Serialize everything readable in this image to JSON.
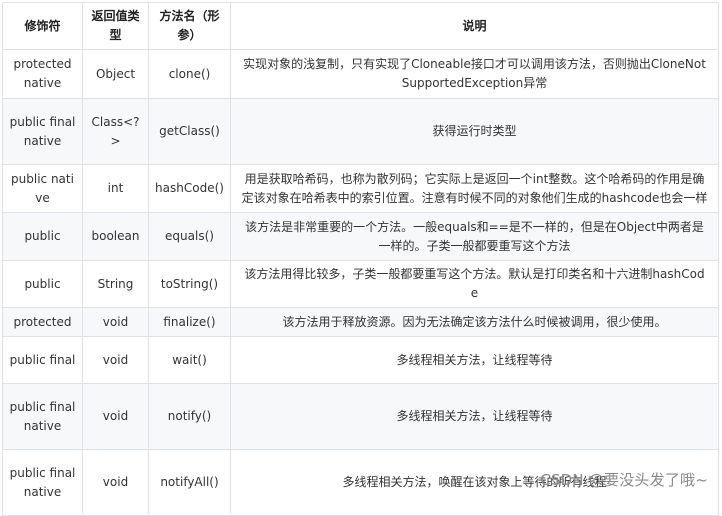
{
  "headers": {
    "modifier": "修饰符",
    "return_type": "返回值类型",
    "method": "方法名（形参）",
    "description": "说明"
  },
  "rows": [
    {
      "modifier": "protected native",
      "return_type": "Object",
      "method": "clone()",
      "description": "实现对象的浅复制，只有实现了Cloneable接口才可以调用该方法，否则抛出CloneNotSupportedException异常"
    },
    {
      "modifier": "public final native",
      "return_type": "Class<?>",
      "method": "getClass()",
      "description": "获得运行时类型"
    },
    {
      "modifier": "public native",
      "return_type": "int",
      "method": "hashCode()",
      "description": "用是获取哈希码，也称为散列码；它实际上是返回一个int整数。这个哈希码的作用是确定该对象在哈希表中的索引位置。注意有时候不同的对象他们生成的hashcode也会一样"
    },
    {
      "modifier": "public",
      "return_type": "boolean",
      "method": "equals()",
      "description": "该方法是非常重要的一个方法。一般equals和==是不一样的，但是在Object中两者是一样的。子类一般都要重写这个方法"
    },
    {
      "modifier": "public",
      "return_type": "String",
      "method": "toString()",
      "description": "该方法用得比较多，子类一般都要重写这个方法。默认是打印类名和十六进制hashCode"
    },
    {
      "modifier": "protected",
      "return_type": "void",
      "method": "finalize()",
      "description": "该方法用于释放资源。因为无法确定该方法什么时候被调用，很少使用。"
    },
    {
      "modifier": "public final",
      "return_type": "void",
      "method": "wait()",
      "description": "多线程相关方法，让线程等待"
    },
    {
      "modifier": "public final native",
      "return_type": "void",
      "method": "notify()",
      "description": "多线程相关方法，让线程等待"
    },
    {
      "modifier": "public final native",
      "return_type": "void",
      "method": "notifyAll()",
      "description": "多线程相关方法，唤醒在该对象上等待的所有线程"
    }
  ],
  "watermark": "CSDN @要没头发了哦~"
}
